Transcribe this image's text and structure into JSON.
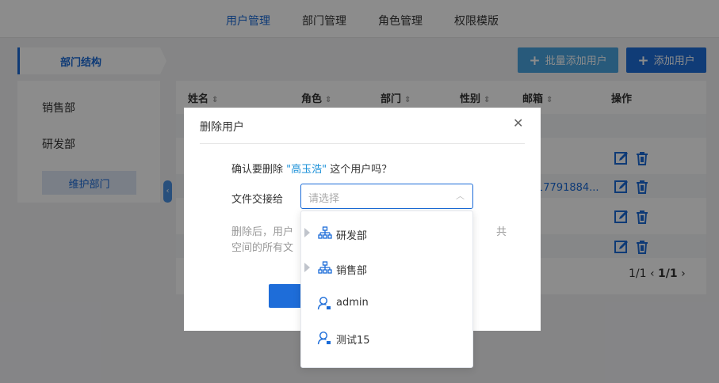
{
  "nav": {
    "tabs": [
      {
        "label": "用户管理",
        "active": true
      },
      {
        "label": "部门管理",
        "active": false
      },
      {
        "label": "角色管理",
        "active": false
      },
      {
        "label": "权限模版",
        "active": false
      }
    ]
  },
  "sidebar": {
    "title": "部门结构",
    "items": [
      "销售部",
      "研发部"
    ],
    "maintain_label": "维护部门"
  },
  "toolbar": {
    "batch_add_label": "批量添加用户",
    "add_label": "添加用户"
  },
  "table": {
    "headers": [
      "姓名",
      "角色",
      "部门",
      "性别",
      "邮箱",
      "操作"
    ],
    "visible_email": "17791884...",
    "pager": {
      "left": "1/1",
      "current": "1/1"
    }
  },
  "dialog": {
    "title": "删除用户",
    "confirm_prefix": "确认要删除",
    "user_name": "\"高玉浩\"",
    "confirm_suffix": "这个用户吗？",
    "transfer_label": "文件交接给",
    "select_placeholder": "请选择",
    "note_line1": "删除后，用户",
    "note_tail": "共",
    "note_line2": "空间的所有文"
  },
  "dropdown": {
    "options": [
      {
        "label": "研发部",
        "type": "department",
        "icon": "org-tree-icon",
        "expandable": true
      },
      {
        "label": "销售部",
        "type": "department",
        "icon": "org-tree-icon",
        "expandable": true
      },
      {
        "label": "admin",
        "type": "user",
        "icon": "user-icon",
        "expandable": false
      },
      {
        "label": "测试15",
        "type": "user",
        "icon": "user-icon",
        "expandable": false
      }
    ]
  },
  "colors": {
    "primary": "#1e6dd9",
    "accent_light": "#49a5e0",
    "link": "#1a6bd8"
  }
}
